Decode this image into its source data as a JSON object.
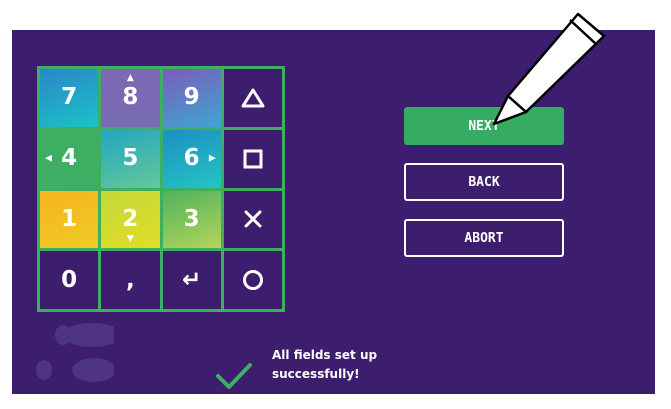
{
  "keypad": {
    "keys": [
      {
        "label": "7"
      },
      {
        "label": "8",
        "hint": "▲"
      },
      {
        "label": "9"
      },
      {
        "label": "",
        "icon": "triangle-icon"
      },
      {
        "label": "4",
        "hint": "◀"
      },
      {
        "label": "5"
      },
      {
        "label": "6",
        "hint": "▶"
      },
      {
        "label": "",
        "icon": "square-icon"
      },
      {
        "label": "1"
      },
      {
        "label": "2",
        "hint": "▼"
      },
      {
        "label": "3"
      },
      {
        "label": "",
        "icon": "cross-icon"
      },
      {
        "label": "0"
      },
      {
        "label": ","
      },
      {
        "label": "↵"
      },
      {
        "label": "",
        "icon": "circle-icon"
      }
    ]
  },
  "buttons": {
    "next_label": "NEXT",
    "back_label": "BACK",
    "abort_label": "ABORT"
  },
  "status": {
    "line1": "All fields set up",
    "line2": "successfully!"
  },
  "colors": {
    "background": "#3c1d6e",
    "accent_green": "#3dae62",
    "text": "#ffffff"
  }
}
